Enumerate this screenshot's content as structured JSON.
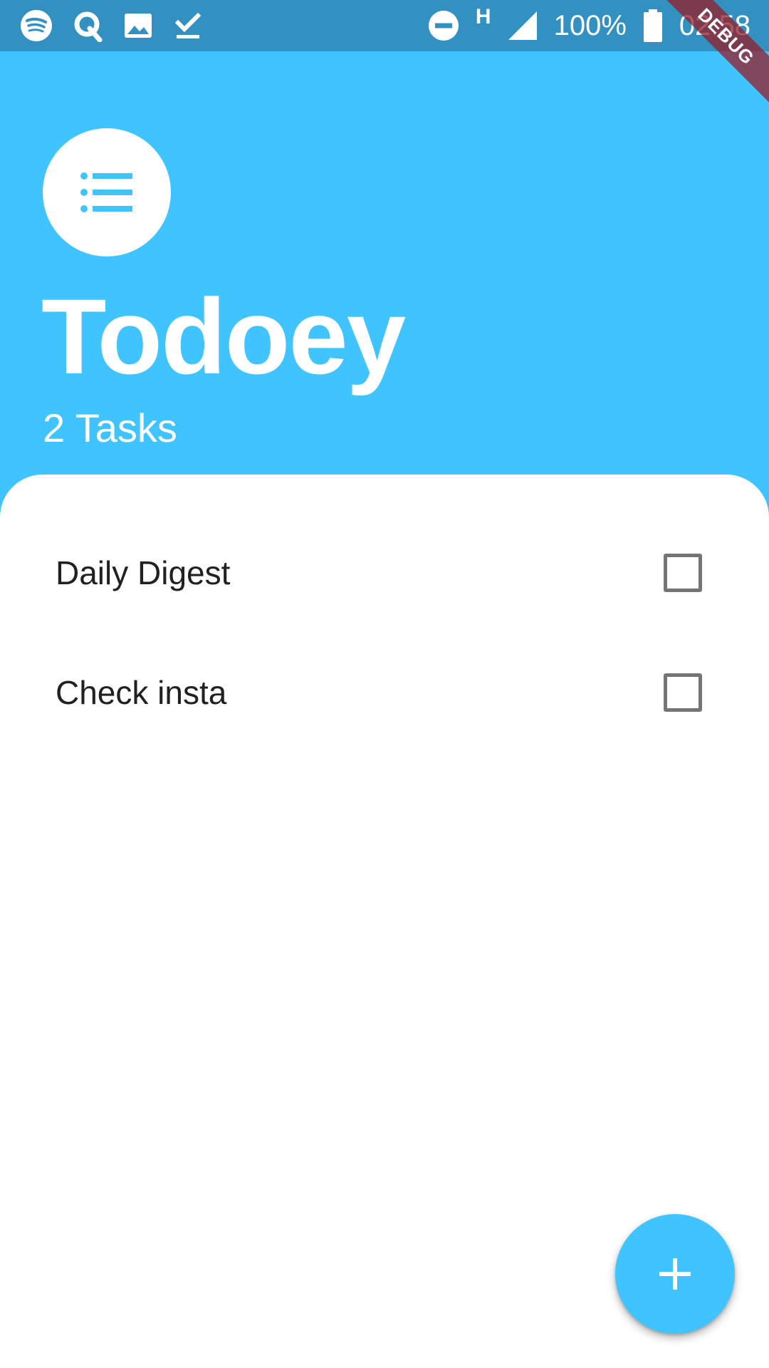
{
  "colors": {
    "accent": "#40C4FF",
    "status_bar": "#3391C2",
    "sheet": "#FFFFFF",
    "task_text": "#212121",
    "checkbox_border": "#757575",
    "debug_banner": "#961E28"
  },
  "status_bar": {
    "left_icons": [
      "spotify-icon",
      "quora-icon",
      "image-icon",
      "download-done-icon"
    ],
    "right_icons": [
      "do-not-disturb-icon",
      "network-type-icon",
      "signal-icon",
      "battery-icon"
    ],
    "network_type": "H",
    "battery_percent": "100%",
    "time": "02:58"
  },
  "debug_banner": {
    "label": "DEBUG"
  },
  "header": {
    "avatar_icon": "list-icon",
    "title": "Todoey",
    "task_count": "2 Tasks"
  },
  "tasks": [
    {
      "title": "Daily Digest",
      "checked": false
    },
    {
      "title": "Check insta",
      "checked": false
    }
  ],
  "fab": {
    "icon": "add-icon"
  }
}
